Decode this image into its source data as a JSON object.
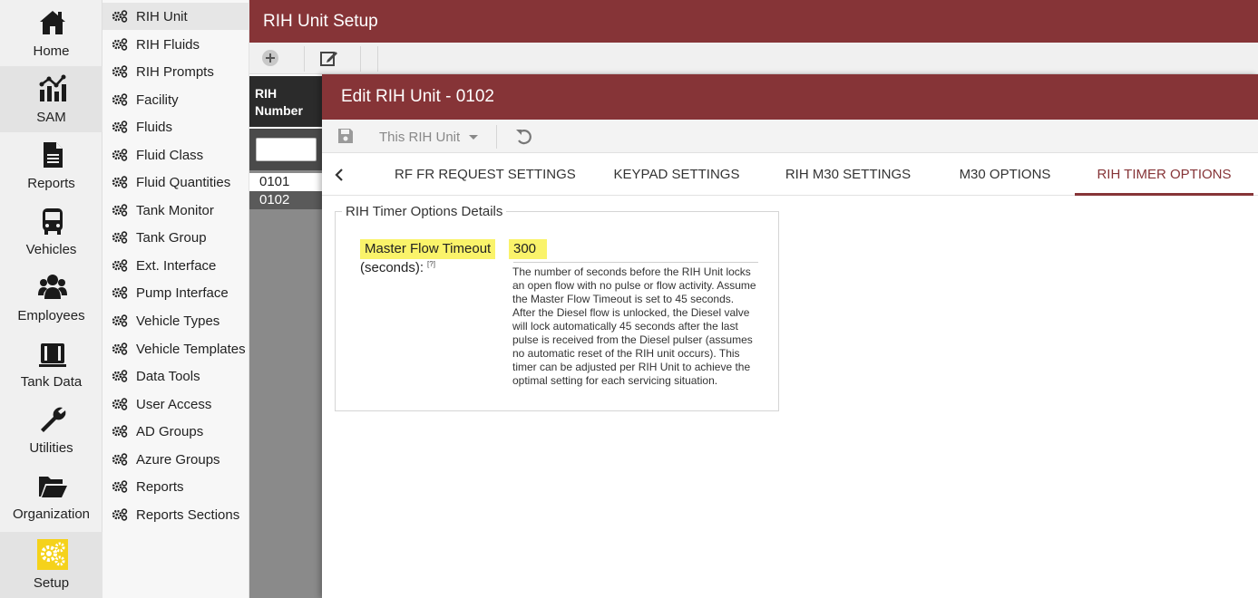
{
  "nav": {
    "items": [
      {
        "label": "Home",
        "icon": "home-icon"
      },
      {
        "label": "SAM",
        "icon": "sam-chart-icon"
      },
      {
        "label": "Reports",
        "icon": "document-icon"
      },
      {
        "label": "Vehicles",
        "icon": "bus-icon"
      },
      {
        "label": "Employees",
        "icon": "users-icon"
      },
      {
        "label": "Tank Data",
        "icon": "tank-icon"
      },
      {
        "label": "Utilities",
        "icon": "wrench-icon"
      },
      {
        "label": "Organization",
        "icon": "folder-icon"
      },
      {
        "label": "Setup",
        "icon": "gears-icon"
      }
    ]
  },
  "submenu": {
    "items": [
      {
        "label": "RIH Unit"
      },
      {
        "label": "RIH Fluids"
      },
      {
        "label": "RIH Prompts"
      },
      {
        "label": "Facility"
      },
      {
        "label": "Fluids"
      },
      {
        "label": "Fluid Class"
      },
      {
        "label": "Fluid Quantities"
      },
      {
        "label": "Tank Monitor"
      },
      {
        "label": "Tank Group"
      },
      {
        "label": "Ext. Interface"
      },
      {
        "label": "Pump Interface"
      },
      {
        "label": "Vehicle Types"
      },
      {
        "label": "Vehicle Templates"
      },
      {
        "label": "Data Tools"
      },
      {
        "label": "User Access"
      },
      {
        "label": "AD Groups"
      },
      {
        "label": "Azure Groups"
      },
      {
        "label": "Reports"
      },
      {
        "label": "Reports Sections"
      }
    ]
  },
  "page": {
    "title": "RIH Unit Setup"
  },
  "grid": {
    "header_line1": "RIH",
    "header_line2": "Number",
    "rows": [
      "0101",
      "0102"
    ]
  },
  "modal": {
    "title": "Edit RIH Unit - 0102",
    "scope": "This RIH Unit",
    "tabs": [
      {
        "label": "RF FR REQUEST SETTINGS"
      },
      {
        "label": "KEYPAD SETTINGS"
      },
      {
        "label": "RIH M30 SETTINGS"
      },
      {
        "label": "M30 OPTIONS"
      },
      {
        "label": "RIH TIMER OPTIONS"
      }
    ],
    "section_title": "RIH Timer Options Details",
    "field": {
      "label_line1": "Master Flow Timeout",
      "label_line2": "(seconds):",
      "help": "[?]",
      "value": "300",
      "description": "The number of seconds before the RIH Unit locks an open flow with no pulse or flow activity. Assume the Master Flow Timeout is set to 45 seconds. After the Diesel flow is unlocked, the Diesel valve will lock automatically 45 seconds after the last pulse is received from the Diesel pulser (assumes no automatic reset of the RIH unit occurs). This timer can be adjusted per RIH Unit to achieve the optimal setting for each servicing situation."
    }
  },
  "colors": {
    "header": "#863437",
    "highlight": "#faf36a",
    "setup_icon": "#f5d21b"
  }
}
